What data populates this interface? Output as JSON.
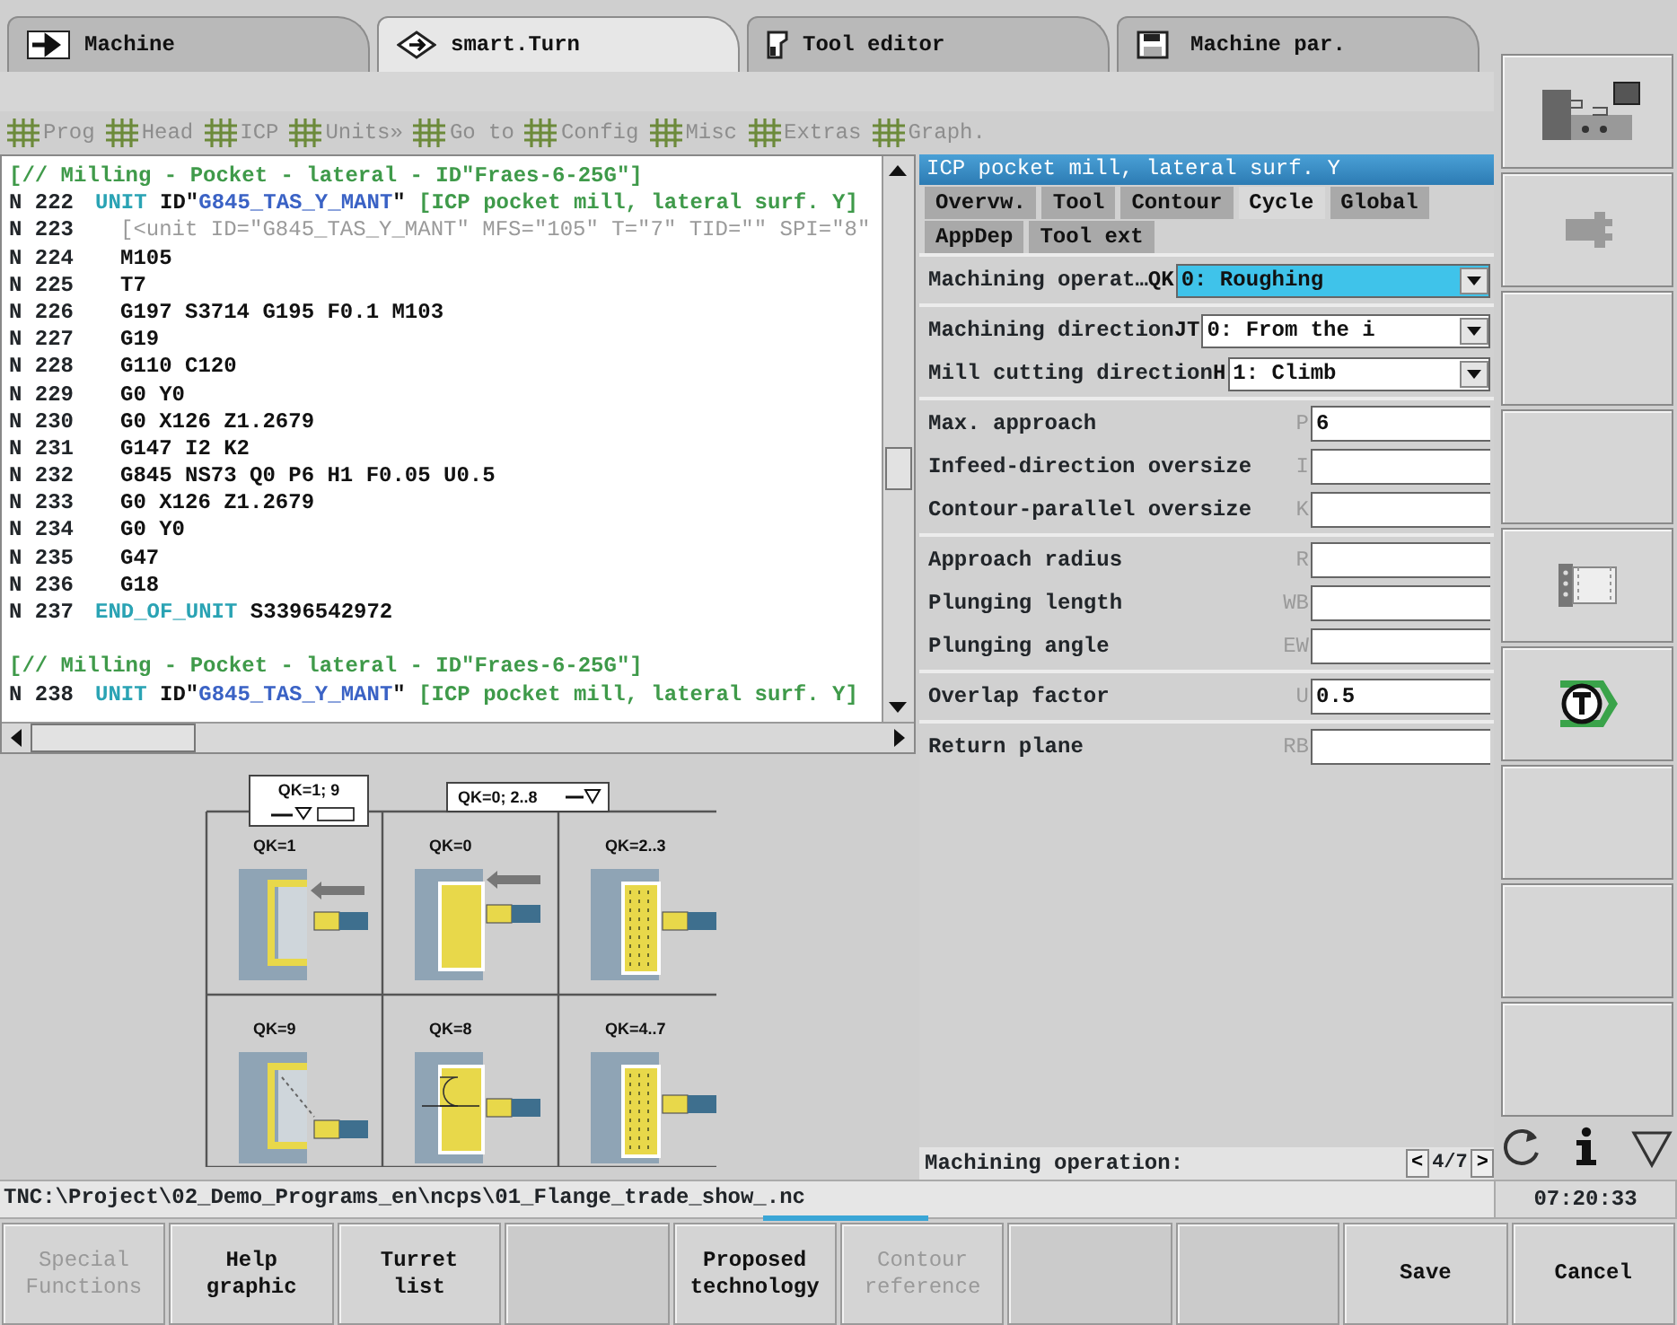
{
  "top_tabs": [
    {
      "label": "Machine",
      "kind": "arrow",
      "selected": false
    },
    {
      "label": "smart.Turn",
      "kind": "diamond",
      "selected": true
    },
    {
      "label": "Tool editor",
      "kind": "tool",
      "selected": false
    },
    {
      "label": "Machine par.",
      "kind": "disk",
      "selected": false
    }
  ],
  "toolbar": [
    {
      "label": "Prog",
      "disabled": true
    },
    {
      "label": "Head",
      "disabled": true
    },
    {
      "label": "ICP",
      "disabled": true
    },
    {
      "label": "Units»",
      "disabled": true
    },
    {
      "label": "Go to",
      "disabled": true
    },
    {
      "label": "Config",
      "disabled": true
    },
    {
      "label": "Misc",
      "disabled": true
    },
    {
      "label": "Extras",
      "disabled": true
    },
    {
      "label": "Graph.",
      "disabled": true
    }
  ],
  "code_lines": [
    {
      "indented": false,
      "gap_before": false,
      "segments": [
        {
          "text": "[// Milling - Pocket - lateral - ID\"Fraes-6-25G\"]",
          "kind": "comment"
        }
      ]
    },
    {
      "number": "N 222",
      "indented": false,
      "gap_before": false,
      "segments": [
        {
          "text": "UNIT",
          "kind": "keyword"
        },
        {
          "text": " ID\"",
          "kind": "plain"
        },
        {
          "text": "G845_TAS_Y_MANT",
          "kind": "id"
        },
        {
          "text": "\"",
          "kind": "plain"
        },
        {
          "text": " [ICP pocket mill, lateral surf. Y]",
          "kind": "comment"
        }
      ]
    },
    {
      "number": "N 223",
      "indented": true,
      "gap_before": false,
      "segments": [
        {
          "text": "[<unit ID=\"G845_TAS_Y_MANT\" MFS=\"105\" T=\"7\" TID=\"\" SPI=\"8\"",
          "kind": "meta"
        }
      ]
    },
    {
      "number": "N 224",
      "indented": true,
      "gap_before": false,
      "segments": [
        {
          "text": "M105",
          "kind": "plain"
        }
      ]
    },
    {
      "number": "N 225",
      "indented": true,
      "gap_before": false,
      "segments": [
        {
          "text": "T7",
          "kind": "plain"
        }
      ]
    },
    {
      "number": "N 226",
      "indented": true,
      "gap_before": false,
      "segments": [
        {
          "text": "G197 S3714 G195 F0.1 M103",
          "kind": "plain"
        }
      ]
    },
    {
      "number": "N 227",
      "indented": true,
      "gap_before": false,
      "segments": [
        {
          "text": "G19",
          "kind": "plain"
        }
      ]
    },
    {
      "number": "N 228",
      "indented": true,
      "gap_before": false,
      "segments": [
        {
          "text": "G110 C120",
          "kind": "plain"
        }
      ]
    },
    {
      "number": "N 229",
      "indented": true,
      "gap_before": false,
      "segments": [
        {
          "text": "G0 Y0",
          "kind": "plain"
        }
      ]
    },
    {
      "number": "N 230",
      "indented": true,
      "gap_before": false,
      "segments": [
        {
          "text": "G0 X126 Z1.2679",
          "kind": "plain"
        }
      ]
    },
    {
      "number": "N 231",
      "indented": true,
      "gap_before": false,
      "segments": [
        {
          "text": "G147 I2 K2",
          "kind": "plain"
        }
      ]
    },
    {
      "number": "N 232",
      "indented": true,
      "gap_before": false,
      "segments": [
        {
          "text": "G845 NS73 Q0 P6 H1 F0.05 U0.5",
          "kind": "plain"
        }
      ]
    },
    {
      "number": "N 233",
      "indented": true,
      "gap_before": false,
      "segments": [
        {
          "text": "G0 X126 Z1.2679",
          "kind": "plain"
        }
      ]
    },
    {
      "number": "N 234",
      "indented": true,
      "gap_before": false,
      "segments": [
        {
          "text": "G0 Y0",
          "kind": "plain"
        }
      ]
    },
    {
      "number": "N 235",
      "indented": true,
      "gap_before": false,
      "segments": [
        {
          "text": "G47",
          "kind": "plain"
        }
      ]
    },
    {
      "number": "N 236",
      "indented": true,
      "gap_before": false,
      "segments": [
        {
          "text": "G18",
          "kind": "plain"
        }
      ]
    },
    {
      "number": "N 237",
      "indented": false,
      "gap_before": false,
      "segments": [
        {
          "text": "END_OF_UNIT",
          "kind": "keyword"
        },
        {
          "text": " S3396542972",
          "kind": "plain"
        }
      ]
    },
    {
      "indented": false,
      "gap_before": true,
      "segments": [
        {
          "text": "[// Milling - Pocket - lateral - ID\"Fraes-6-25G\"]",
          "kind": "comment"
        }
      ]
    },
    {
      "number": "N 238",
      "indented": false,
      "gap_before": false,
      "segments": [
        {
          "text": "UNIT",
          "kind": "keyword"
        },
        {
          "text": " ID\"",
          "kind": "plain"
        },
        {
          "text": "G845_TAS_Y_MANT",
          "kind": "id"
        },
        {
          "text": "\"",
          "kind": "plain"
        },
        {
          "text": " [ICP pocket mill, lateral surf. Y]",
          "kind": "comment"
        }
      ]
    }
  ],
  "help_graphic": {
    "captions": [
      "QK=1; 9",
      "QK=0; 2..8"
    ],
    "cells": [
      {
        "label": "QK=1",
        "kind": "contour"
      },
      {
        "label": "QK=0",
        "kind": "pocket"
      },
      {
        "label": "QK=2..3",
        "kind": "hatched"
      },
      {
        "label": "QK=9",
        "kind": "contour_plunge"
      },
      {
        "label": "QK=8",
        "kind": "pocket_plunge"
      },
      {
        "label": "QK=4..7",
        "kind": "hatched"
      }
    ]
  },
  "form": {
    "title": "ICP pocket mill, lateral surf. Y",
    "tab_rows": [
      [
        {
          "label": "Overvw.",
          "selected": false
        },
        {
          "label": "Tool",
          "selected": false
        },
        {
          "label": "Contour",
          "selected": false
        },
        {
          "label": "Cycle",
          "selected": true
        },
        {
          "label": "Global",
          "selected": false
        }
      ],
      [
        {
          "label": "AppDep",
          "selected": false
        },
        {
          "label": "Tool ext",
          "selected": false
        }
      ]
    ],
    "groups": [
      [
        {
          "label": "Machining operat…",
          "address": "QK",
          "value": "0: Roughing",
          "kind": "select",
          "focused": true
        }
      ],
      [
        {
          "label": "Machining direction",
          "address": "JT",
          "value": "0: From the i",
          "kind": "select",
          "focused": false
        },
        {
          "label": "Mill cutting direction",
          "address": "H",
          "value": "1: Climb",
          "kind": "select",
          "focused": false
        }
      ],
      [
        {
          "label": "Max. approach",
          "address": "P",
          "value": "6",
          "kind": "input",
          "focused": false
        },
        {
          "label": "Infeed-direction oversize",
          "address": "I",
          "kind": "input",
          "focused": false
        },
        {
          "label": "Contour-parallel oversize",
          "address": "K",
          "kind": "input",
          "focused": false
        }
      ],
      [
        {
          "label": "Approach radius",
          "address": "R",
          "kind": "input",
          "focused": false
        },
        {
          "label": "Plunging length",
          "address": "WB",
          "kind": "input",
          "focused": false
        },
        {
          "label": "Plunging angle",
          "address": "EW",
          "kind": "input",
          "focused": false
        }
      ],
      [
        {
          "label": "Overlap factor",
          "address": "U",
          "value": "0.5",
          "kind": "input",
          "focused": false
        }
      ],
      [
        {
          "label": "Return plane",
          "address": "RB",
          "kind": "input",
          "focused": false
        }
      ]
    ],
    "info": {
      "label": "Machining operation:",
      "prev": "<",
      "page": "4/7",
      "next": ">"
    }
  },
  "side_keys": [
    {
      "kind": "machine"
    },
    {
      "kind": "plug"
    },
    {
      "kind": "blank"
    },
    {
      "kind": "blank"
    },
    {
      "kind": "film"
    },
    {
      "kind": "turret"
    },
    {
      "kind": "blank"
    },
    {
      "kind": "blank"
    },
    {
      "kind": "blank"
    }
  ],
  "path": "TNC:\\Project\\02_Demo_Programs_en\\ncps\\01_Flange_trade_show_.nc",
  "time": "07:20:33",
  "softkeys": [
    {
      "lines": [
        "Special",
        "Functions"
      ],
      "disabled": true
    },
    {
      "lines": [
        "Help",
        "graphic"
      ],
      "disabled": false
    },
    {
      "lines": [
        "Turret",
        "list"
      ],
      "disabled": false
    },
    {
      "kind": "blank"
    },
    {
      "lines": [
        "Proposed",
        "technology"
      ],
      "disabled": false
    },
    {
      "lines": [
        "Contour",
        "reference"
      ],
      "disabled": true
    },
    {
      "kind": "blank"
    },
    {
      "kind": "blank"
    },
    {
      "lines": [
        "Save"
      ],
      "disabled": false
    },
    {
      "lines": [
        "Cancel"
      ],
      "disabled": false
    }
  ]
}
